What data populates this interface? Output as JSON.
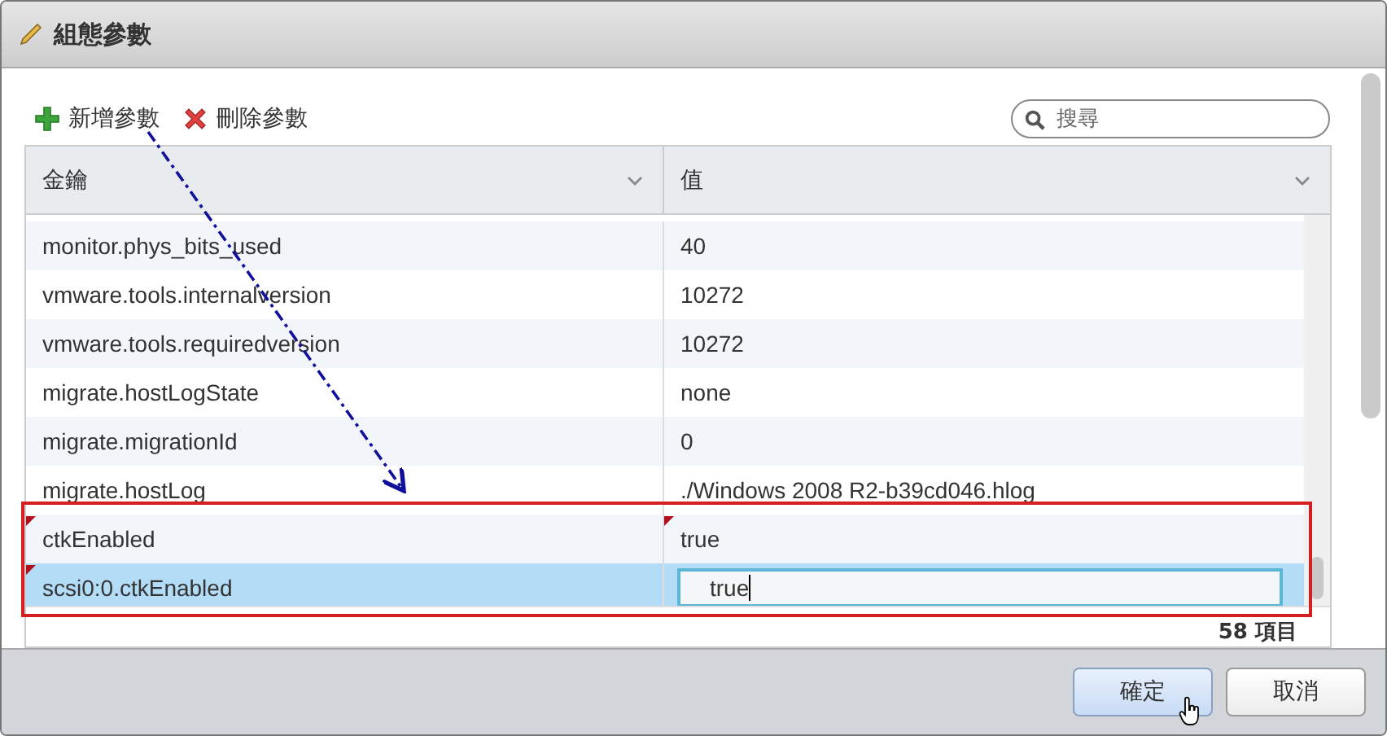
{
  "window": {
    "title": "組態參數"
  },
  "toolbar": [
    {
      "label": "新增參數",
      "kind": "add"
    },
    {
      "label": "刪除參數",
      "kind": "delete"
    }
  ],
  "search": {
    "placeholder": "搜尋"
  },
  "table": {
    "columns": [
      "金鑰",
      "值"
    ],
    "rows": [
      {
        "key": "monitor.phys_bits_used",
        "value": "40",
        "modified": false,
        "selected": false,
        "editing": false
      },
      {
        "key": "vmware.tools.internalversion",
        "value": "10272",
        "modified": false,
        "selected": false,
        "editing": false
      },
      {
        "key": "vmware.tools.requiredversion",
        "value": "10272",
        "modified": false,
        "selected": false,
        "editing": false
      },
      {
        "key": "migrate.hostLogState",
        "value": "none",
        "modified": false,
        "selected": false,
        "editing": false
      },
      {
        "key": "migrate.migrationId",
        "value": "0",
        "modified": false,
        "selected": false,
        "editing": false
      },
      {
        "key": "migrate.hostLog",
        "value": "./Windows 2008 R2-b39cd046.hlog",
        "modified": false,
        "selected": false,
        "editing": false
      },
      {
        "key": "ctkEnabled",
        "value": "true",
        "modified": true,
        "selected": false,
        "editing": false
      },
      {
        "key": "scsi0:0.ctkEnabled",
        "value": "true",
        "modified": true,
        "selected": true,
        "editing": true
      }
    ],
    "count": "58 項目"
  },
  "buttons": [
    {
      "label": "確定",
      "primary": true
    },
    {
      "label": "取消",
      "primary": false
    }
  ]
}
